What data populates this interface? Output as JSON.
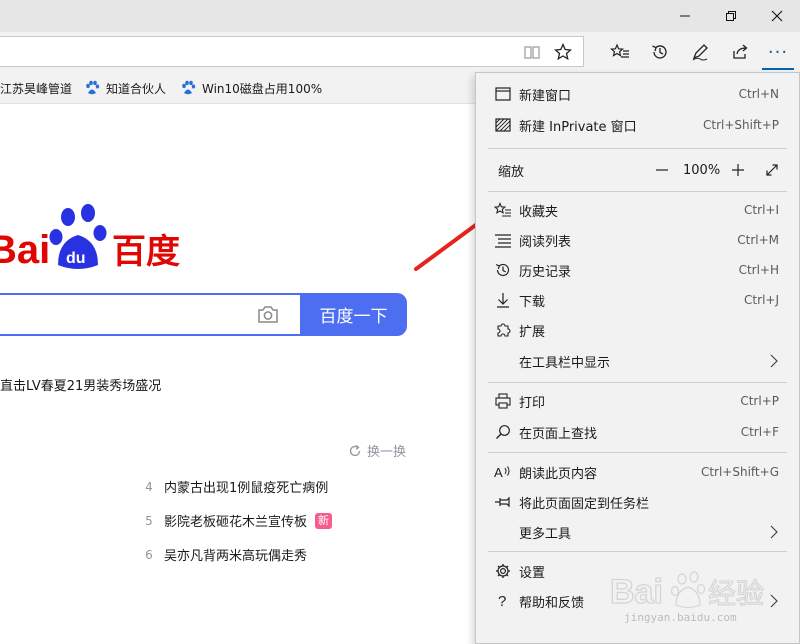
{
  "favorites": [
    {
      "label": "江苏昊峰管道"
    },
    {
      "label": "知道合伙人"
    },
    {
      "label": "Win10磁盘占用100%"
    }
  ],
  "page": {
    "logo_text": "Bai百度",
    "search_button": "百度一下",
    "news_top": "直击LV春夏21男装秀场盛况",
    "refresh_label": "换一换",
    "hot_items": [
      {
        "num": "4",
        "text": "内蒙古出现1例鼠疫死亡病例",
        "tag": ""
      },
      {
        "num": "5",
        "text": "影院老板砸花木兰宣传板",
        "tag": "新"
      },
      {
        "num": "6",
        "text": "吴亦凡背两米高玩偶走秀",
        "tag": ""
      }
    ]
  },
  "menu": {
    "new_window": {
      "label": "新建窗口",
      "shortcut": "Ctrl+N"
    },
    "new_inprivate": {
      "label": "新建 InPrivate 窗口",
      "shortcut": "Ctrl+Shift+P"
    },
    "zoom": {
      "label": "缩放",
      "value": "100%"
    },
    "favorites": {
      "label": "收藏夹",
      "shortcut": "Ctrl+I"
    },
    "reading_list": {
      "label": "阅读列表",
      "shortcut": "Ctrl+M"
    },
    "history": {
      "label": "历史记录",
      "shortcut": "Ctrl+H"
    },
    "downloads": {
      "label": "下载",
      "shortcut": "Ctrl+J"
    },
    "extensions": {
      "label": "扩展"
    },
    "show_in_toolbar": {
      "label": "在工具栏中显示"
    },
    "print": {
      "label": "打印",
      "shortcut": "Ctrl+P"
    },
    "find": {
      "label": "在页面上查找",
      "shortcut": "Ctrl+F"
    },
    "read_aloud": {
      "label": "朗读此页内容",
      "shortcut": "Ctrl+Shift+G"
    },
    "pin_taskbar": {
      "label": "将此页面固定到任务栏"
    },
    "more_tools": {
      "label": "更多工具"
    },
    "settings": {
      "label": "设置"
    },
    "help": {
      "label": "帮助和反馈"
    }
  },
  "watermark": {
    "text": "jingyan.baidu.com"
  },
  "colors": {
    "accent": "#0063b1",
    "baidu_blue": "#4e6ef2",
    "baidu_red": "#e10602",
    "arrow_red": "#e8231e"
  }
}
